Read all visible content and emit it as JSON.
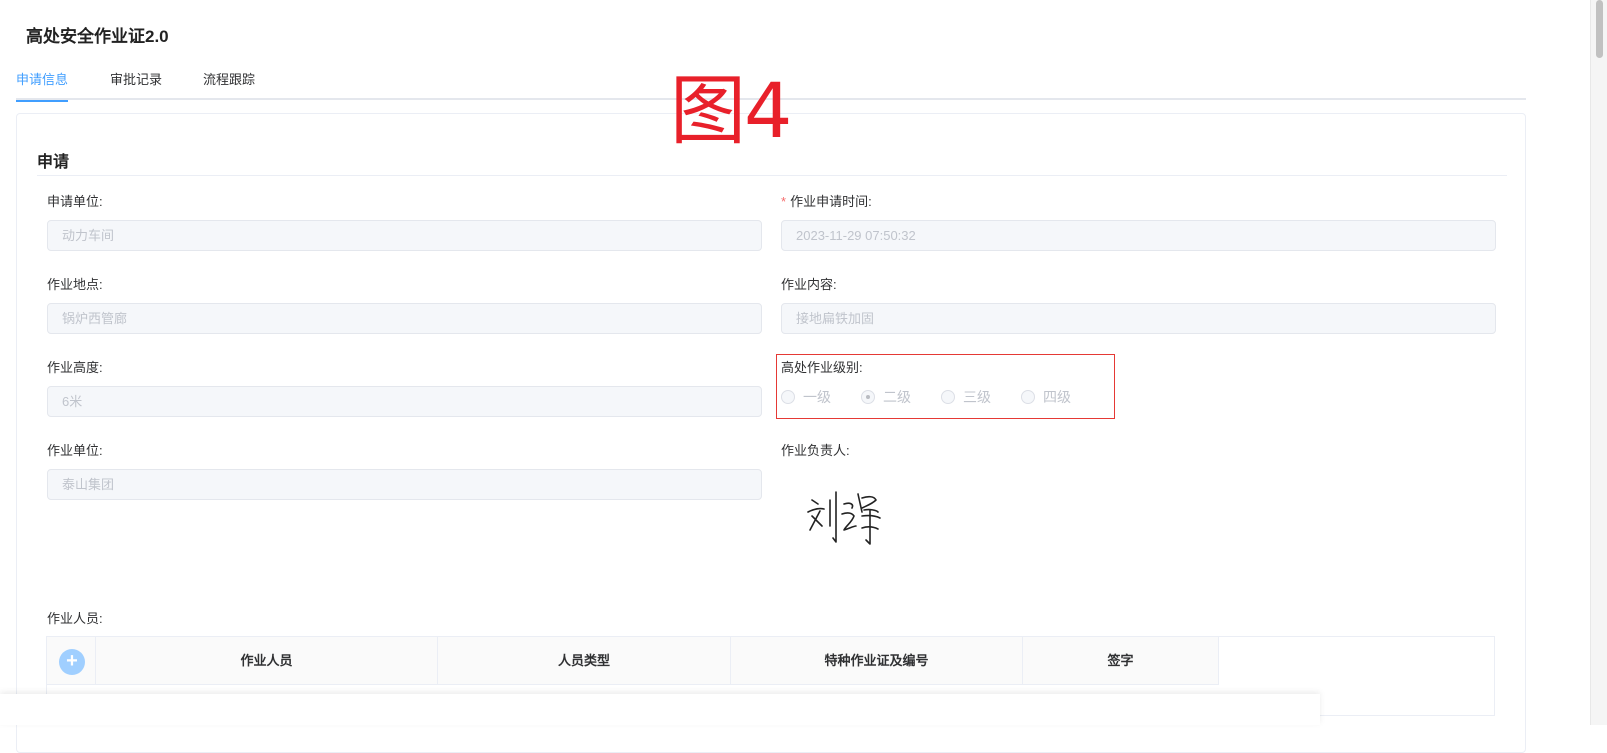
{
  "page": {
    "title": "高处安全作业证2.0",
    "overlay_label": "图4"
  },
  "tabs": [
    {
      "label": "申请信息",
      "active": true
    },
    {
      "label": "审批记录",
      "active": false
    },
    {
      "label": "流程跟踪",
      "active": false
    }
  ],
  "section": {
    "title": "申请"
  },
  "fields": {
    "apply_unit": {
      "label": "申请单位:",
      "value": "动力车间"
    },
    "apply_time": {
      "required_mark": "*",
      "label": "作业申请时间:",
      "value": "2023-11-29 07:50:32"
    },
    "location": {
      "label": "作业地点:",
      "value": "锅炉西管廊"
    },
    "content": {
      "label": "作业内容:",
      "value": "接地扁铁加固"
    },
    "height": {
      "label": "作业高度:",
      "value": "6米"
    },
    "level": {
      "label": "高处作业级别:",
      "options": [
        "一级",
        "二级",
        "三级",
        "四级"
      ],
      "selected": "二级"
    },
    "work_unit": {
      "label": "作业单位:",
      "value": "泰山集团"
    },
    "leader": {
      "label": "作业负责人:"
    },
    "workers": {
      "label": "作业人员:"
    }
  },
  "table": {
    "add_symbol": "+",
    "columns": [
      "作业人员",
      "人员类型",
      "特种作业证及编号",
      "签字"
    ]
  },
  "colors": {
    "accent": "#409eff",
    "highlight_box": "#e53935",
    "overlay_text": "#e8202a"
  }
}
